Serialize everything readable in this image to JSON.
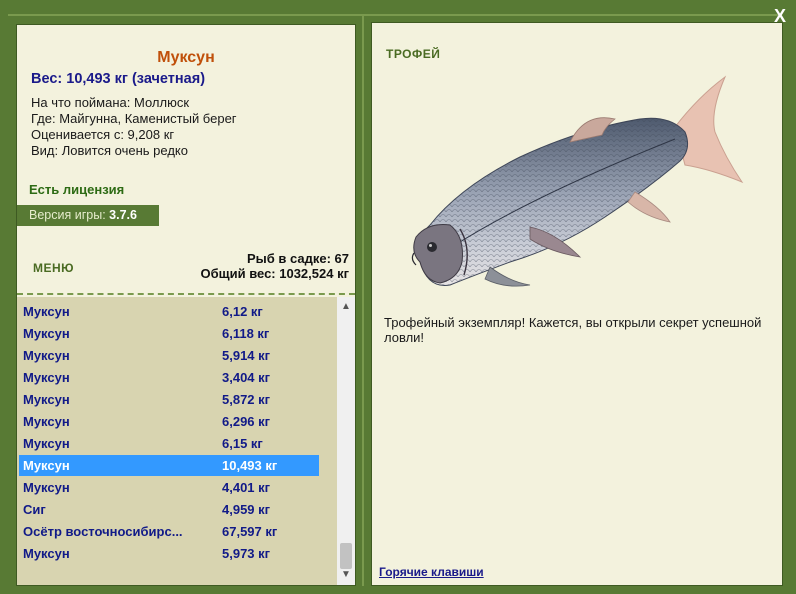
{
  "window": {
    "close_label": "X"
  },
  "fish": {
    "name": "Муксун",
    "weight": "Вес: 10,493 кг (зачетная)",
    "bait": "На что поймана: Моллюск",
    "location": "Где: Майгунна, Каменистый берег",
    "estimated": "Оценивается с: 9,208 кг",
    "species": "Вид: Ловится очень редко"
  },
  "license": "Есть лицензия",
  "version": {
    "label": "Версия игры:",
    "value": "3.7.6"
  },
  "menu_label": "МЕНЮ",
  "keep": {
    "count": "Рыб в садке: 67",
    "total": "Общий вес: 1032,524 кг"
  },
  "catch_list": [
    {
      "name": "Муксун",
      "weight": "6,12 кг"
    },
    {
      "name": "Муксун",
      "weight": "6,118 кг"
    },
    {
      "name": "Муксун",
      "weight": "5,914 кг"
    },
    {
      "name": "Муксун",
      "weight": "3,404 кг"
    },
    {
      "name": "Муксун",
      "weight": "5,872 кг"
    },
    {
      "name": "Муксун",
      "weight": "6,296 кг"
    },
    {
      "name": "Муксун",
      "weight": "6,15 кг"
    },
    {
      "name": "Муксун",
      "weight": "10,493 кг",
      "selected": true
    },
    {
      "name": "Муксун",
      "weight": "4,401 кг"
    },
    {
      "name": "Сиг",
      "weight": "4,959 кг"
    },
    {
      "name": "Осётр восточносибирс...",
      "weight": "67,597 кг"
    },
    {
      "name": "Муксун",
      "weight": "5,973 кг"
    }
  ],
  "trophy": {
    "label": "ТРОФЕЙ",
    "text": "Трофейный экземпляр! Кажется, вы открыли секрет успешной ловли!"
  },
  "hotkeys_label": "Горячие клавиши",
  "colors": {
    "frame": "#587a34",
    "panel": "#f3f2dd",
    "list_bg": "#d8d4b0",
    "selected": "#3399ff",
    "title": "#c0500a",
    "name_text": "#111a88"
  }
}
